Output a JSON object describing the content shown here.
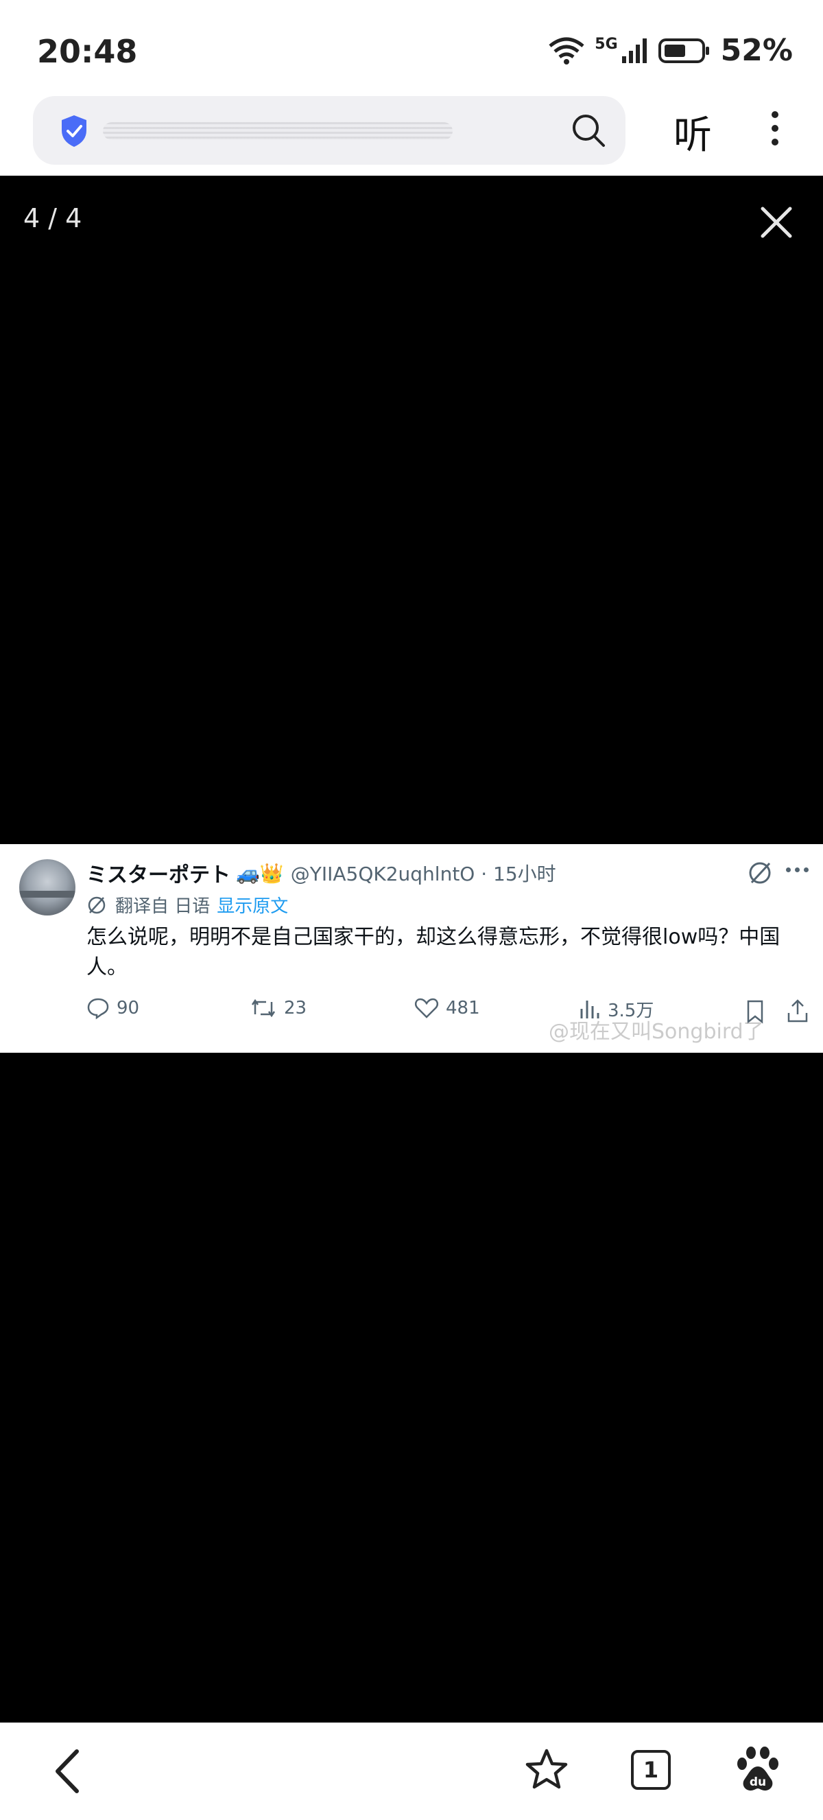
{
  "status_bar": {
    "time": "20:48",
    "network": "5G",
    "battery": "52%",
    "icons": [
      "wifi-icon",
      "signal-icon",
      "battery-icon"
    ]
  },
  "toolbar": {
    "listen_label": "听",
    "icons": [
      "shield-icon",
      "search-icon",
      "more-icon"
    ]
  },
  "viewer": {
    "counter": "4 / 4",
    "close_icon": "close-icon"
  },
  "tweet": {
    "name": "ミスターポテト",
    "emoji": "🚙👑",
    "handle": "@YIIA5QK2uqhlntO · 15小时",
    "translated_from": "翻译自 日语",
    "show_original": "显示原文",
    "text": "怎么说呢，明明不是自己国家干的，却这么得意忘形，不觉得很low吗？中国人。",
    "replies": "90",
    "retweets": "23",
    "likes": "481",
    "views": "3.5万",
    "watermark": "@现在又叫Songbird了"
  },
  "bottom_nav": {
    "tab_count": "1",
    "icons": [
      "back-icon",
      "star-icon",
      "tabs-icon",
      "baidu-icon"
    ]
  }
}
